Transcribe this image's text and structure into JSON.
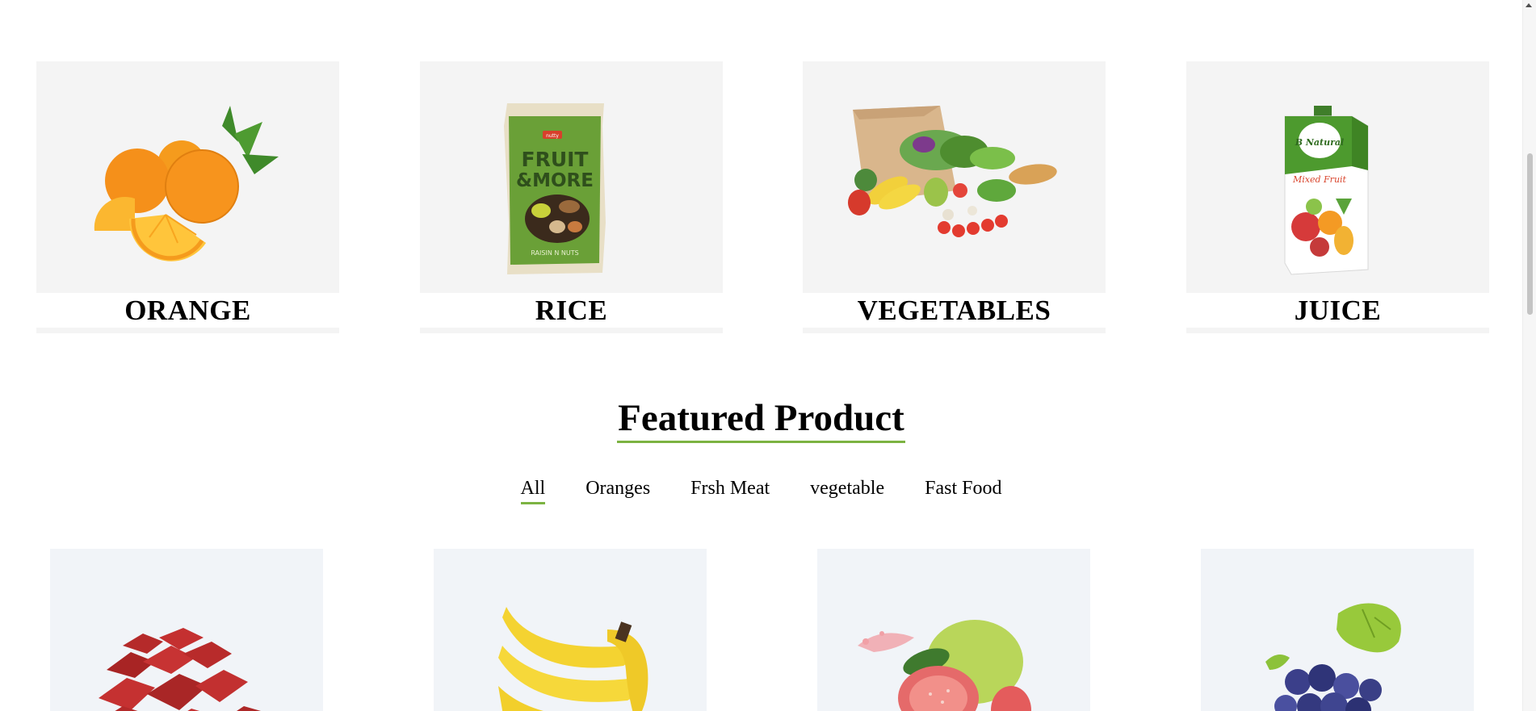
{
  "categories": [
    {
      "label": "ORANGE",
      "image": "oranges-image"
    },
    {
      "label": "RICE",
      "image": "fruit-and-more-pack-image",
      "pack_brand": "nutty",
      "pack_title_1": "FRUIT",
      "pack_title_2": "&MORE",
      "pack_sub": "RAISIN N NUTS"
    },
    {
      "label": "VEGETABLES",
      "image": "grocery-bag-image"
    },
    {
      "label": "JUICE",
      "image": "juice-carton-image",
      "pack_brand": "B Natural",
      "pack_flavor": "Mixed Fruit"
    }
  ],
  "featured": {
    "title": "Featured Product",
    "filters": [
      "All",
      "Oranges",
      "Frsh Meat",
      "vegetable",
      "Fast Food"
    ],
    "active_filter": "All"
  },
  "products": [
    {
      "image": "meat-cubes-image"
    },
    {
      "image": "bananas-image"
    },
    {
      "image": "guava-image"
    },
    {
      "image": "grapes-image"
    }
  ],
  "colors": {
    "accent": "#7cb342",
    "card_bg": "#f4f4f4",
    "product_bg": "#f1f4f8"
  }
}
